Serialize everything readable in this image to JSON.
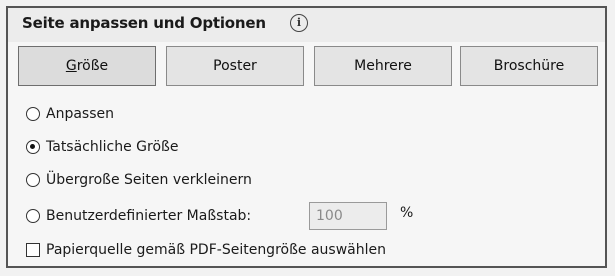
{
  "header": {
    "title": "Seite anpassen und Optionen",
    "info_icon": "info-icon"
  },
  "tabs": [
    {
      "prefix": "",
      "mnemonic": "G",
      "rest": "röße",
      "label": "Größe",
      "active": true
    },
    {
      "label": "Poster"
    },
    {
      "label": "Mehrere"
    },
    {
      "label": "Broschüre"
    }
  ],
  "options": {
    "fit": {
      "label": "Anpassen",
      "selected": false
    },
    "actual": {
      "label": "Tatsächliche Größe",
      "selected": true
    },
    "shrink": {
      "label": "Übergroße Seiten verkleinern",
      "selected": false
    },
    "custom": {
      "label": "Benutzerdefinierter Maßstab:",
      "selected": false,
      "value": "100",
      "unit": "%"
    }
  },
  "paper_source": {
    "label": "Papierquelle gemäß PDF-Seitengröße auswählen",
    "checked": false
  }
}
